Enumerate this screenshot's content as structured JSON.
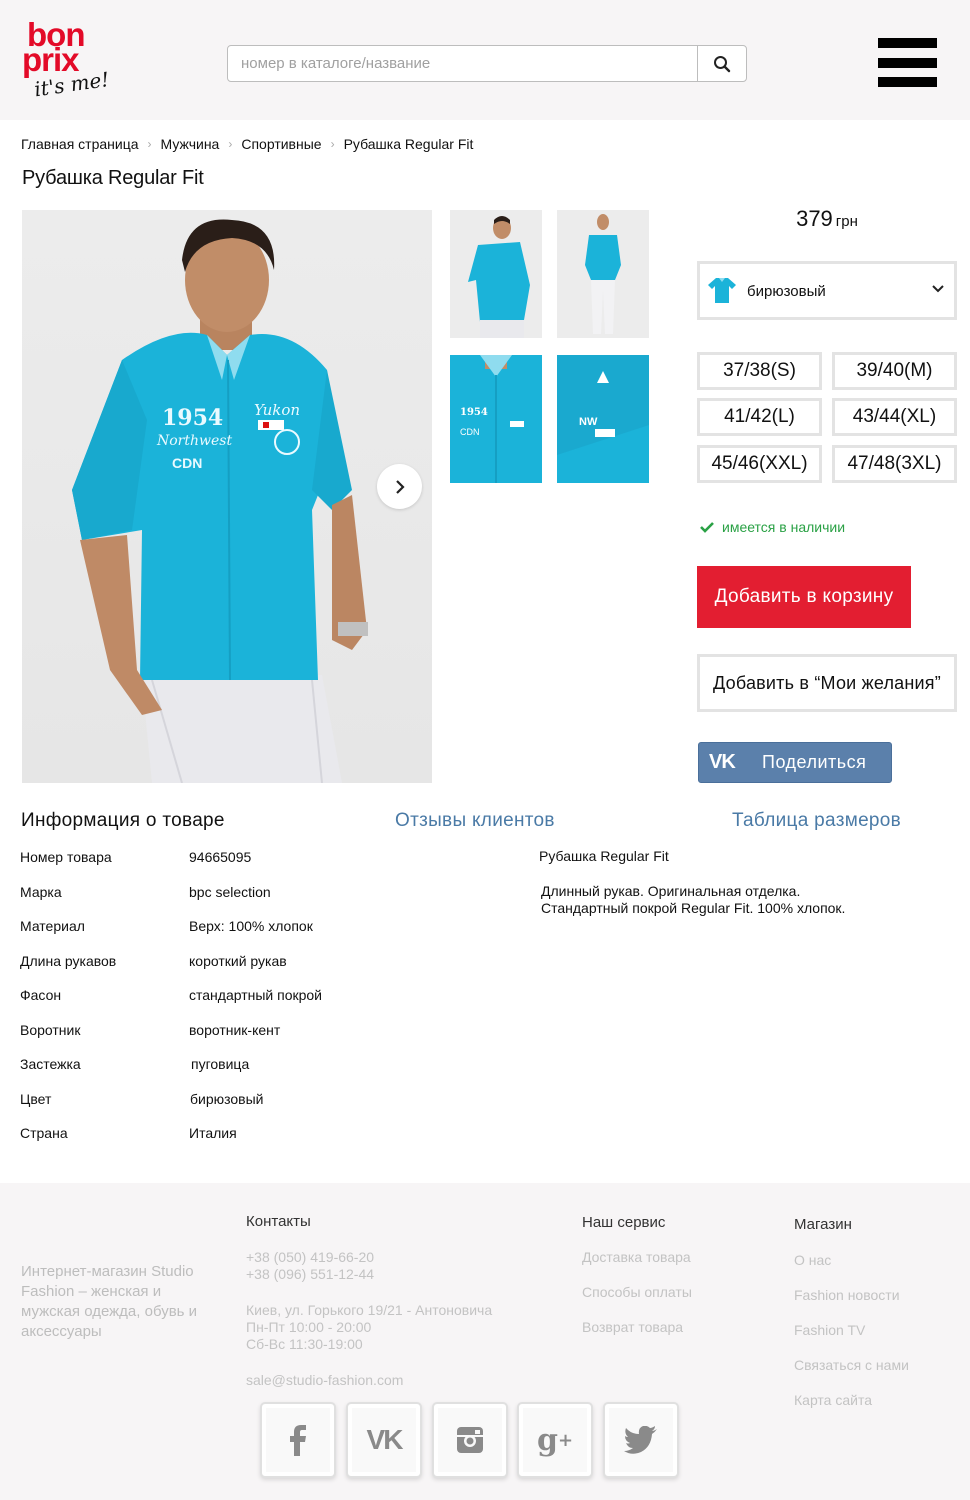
{
  "header": {
    "logo": {
      "line1": "bon",
      "line2": "prix",
      "tagline": "it's me!"
    },
    "search": {
      "placeholder": "номер в каталоге/название",
      "button_icon": "search-icon"
    },
    "menu_icon": "hamburger-menu-icon"
  },
  "breadcrumb": [
    "Главная страница",
    "Мужчина",
    "Спортивные",
    "Рубашка Regular Fit"
  ],
  "product": {
    "title": "Рубашка Regular Fit",
    "price_value": "379",
    "price_currency": "грн",
    "color": "бирюзовый",
    "sizes": [
      "37/38(S)",
      "39/40(M)",
      "41/42(L)",
      "43/44(XL)",
      "45/46(XXL)",
      "47/48(3XL)"
    ],
    "stock_status": "имеется в наличии",
    "add_to_cart": "Добавить в корзину",
    "add_to_wishlist": "Добавить в “Мои желания”",
    "share_vk": "Поделиться"
  },
  "tabs": [
    "Информация о товаре",
    "Отзывы клиентов",
    "Таблица размеров"
  ],
  "details": [
    {
      "key": "Номер товара",
      "value": "94665095"
    },
    {
      "key": "Марка",
      "value": "bpc selection"
    },
    {
      "key": "Материал",
      "value": "Верх: 100% хлопок"
    },
    {
      "key": "Длина рукавов",
      "value": "короткий рукав"
    },
    {
      "key": "Фасон",
      "value": "стандартный покрой"
    },
    {
      "key": "Воротник",
      "value": "воротник-кент"
    },
    {
      "key": "Застежка",
      "value": "пуговица"
    },
    {
      "key": "Цвет",
      "value": "бирюзовый"
    },
    {
      "key": "Страна",
      "value": "Италия"
    }
  ],
  "description": {
    "title": "Рубашка Regular Fit",
    "line1": "Длинный рукав. Оригинальная отделка.",
    "line2": "Стандартный покрой Regular Fit. 100% хлопок."
  },
  "footer": {
    "about": "Интернет-магазин Studio Fashion – женская и мужская одежда, обувь и аксессуары",
    "contacts": {
      "title": "Контакты",
      "phone1": "+38 (050) 419-66-20",
      "phone2": "+38 (096) 551-12-44",
      "address": "Киев, ул. Горького 19/21 - Антоновича",
      "hours1": "Пн-Пт 10:00 - 20:00",
      "hours2": "Сб-Вс 11:30-19:00",
      "email": "sale@studio-fashion.com"
    },
    "service": {
      "title": "Наш сервис",
      "links": [
        "Доставка товара",
        "Способы оплаты",
        "Возврат товара"
      ]
    },
    "shop": {
      "title": "Магазин",
      "links": [
        "О нас",
        "Fashion новости",
        "Fashion TV",
        "Связаться с нами",
        "Карта сайта"
      ]
    },
    "social_icons": [
      "facebook-icon",
      "vk-icon",
      "instagram-icon",
      "google-plus-icon",
      "twitter-icon"
    ]
  },
  "colors": {
    "accent_red": "#e31e31",
    "stock_green": "#2aa145",
    "link_blue": "#4a7aa6",
    "vk_blue": "#5b80ab",
    "shirt_turquoise": "#1bb3d9"
  }
}
